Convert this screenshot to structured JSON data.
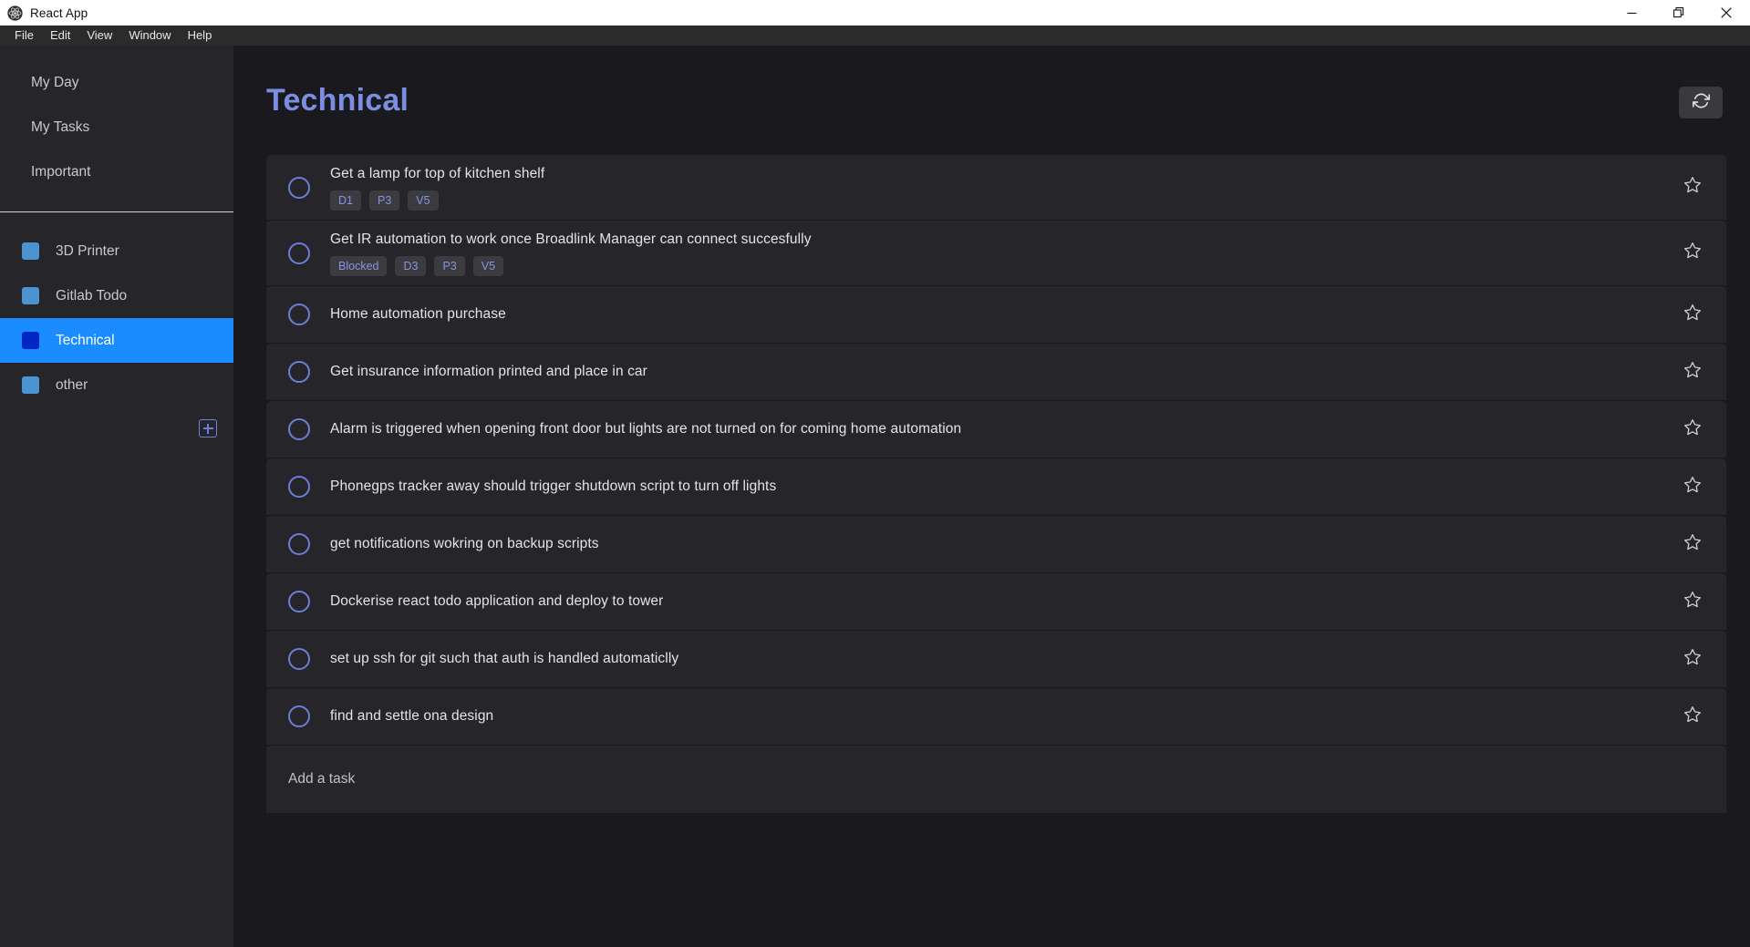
{
  "window": {
    "title": "React App",
    "logo_icon": "react-logo-icon",
    "controls": [
      {
        "name": "minimize-button",
        "icon": "minimize-icon"
      },
      {
        "name": "maximize-button",
        "icon": "restore-icon"
      },
      {
        "name": "close-button",
        "icon": "close-icon"
      }
    ]
  },
  "menubar": {
    "items": [
      {
        "label": "File"
      },
      {
        "label": "Edit"
      },
      {
        "label": "View"
      },
      {
        "label": "Window"
      },
      {
        "label": "Help"
      }
    ]
  },
  "sidebar": {
    "nav": [
      {
        "label": "My Day"
      },
      {
        "label": "My Tasks"
      },
      {
        "label": "Important"
      }
    ],
    "lists": [
      {
        "label": "3D Printer",
        "color": "#4b93d1",
        "active": false
      },
      {
        "label": "Gitlab Todo",
        "color": "#4b93d1",
        "active": false
      },
      {
        "label": "Technical",
        "color": "#0027c4",
        "active": true
      },
      {
        "label": "other",
        "color": "#4b93d1",
        "active": false
      }
    ],
    "add_list": {
      "icon": "plus-square-icon"
    }
  },
  "main": {
    "title": "Technical",
    "title_color": "#7b8ee3",
    "refresh": {
      "icon": "refresh-icon"
    },
    "add_task": {
      "placeholder": "Add a task",
      "value": ""
    },
    "tasks": [
      {
        "title": "Get a lamp for top of kitchen shelf",
        "tags": [
          "D1",
          "P3",
          "V5"
        ],
        "completed": false,
        "starred": false
      },
      {
        "title": "Get IR automation to work once Broadlink Manager can connect succesfully",
        "tags": [
          "Blocked",
          "D3",
          "P3",
          "V5"
        ],
        "completed": false,
        "starred": false
      },
      {
        "title": "Home automation purchase",
        "tags": [],
        "completed": false,
        "starred": false
      },
      {
        "title": "Get insurance information printed and place in car",
        "tags": [],
        "completed": false,
        "starred": false
      },
      {
        "title": "Alarm is triggered when opening front door but lights are not turned on for coming home automation",
        "tags": [],
        "completed": false,
        "starred": false
      },
      {
        "title": "Phonegps tracker away should trigger shutdown script to turn off lights",
        "tags": [],
        "completed": false,
        "starred": false
      },
      {
        "title": "get notifications wokring on backup scripts",
        "tags": [],
        "completed": false,
        "starred": false
      },
      {
        "title": "Dockerise react todo application and deploy to tower",
        "tags": [],
        "completed": false,
        "starred": false
      },
      {
        "title": "set up ssh for git such that auth is handled automaticlly",
        "tags": [],
        "completed": false,
        "starred": false
      },
      {
        "title": "find and settle ona design",
        "tags": [],
        "completed": false,
        "starred": false
      }
    ]
  },
  "colors": {
    "accent_selected": "#1a8cff",
    "accent_title": "#7b8ee3",
    "checkbox": "#6b7fd7",
    "tag_text": "#8795e0",
    "row_bg": "#26262a",
    "page_bg": "#1a1a1e"
  }
}
